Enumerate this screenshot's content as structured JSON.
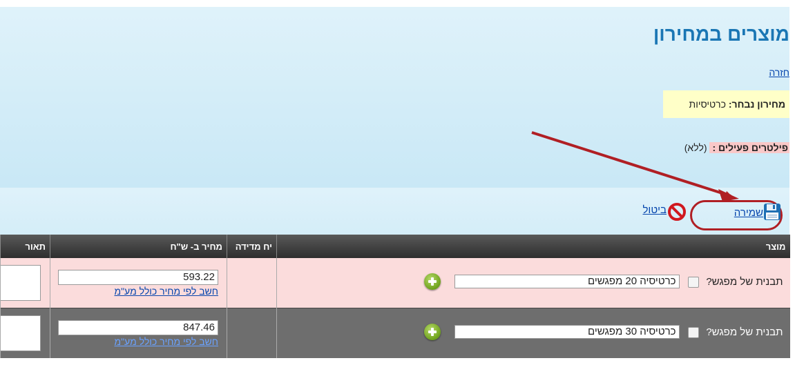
{
  "header": {
    "title": "מוצרים במחירון",
    "back_link": "חזרה",
    "pricelist_label": "מחירון נבחר:",
    "pricelist_value": "כרטיסיות",
    "filters_label": "פילטרים פעילים :",
    "filters_value": "(ללא)"
  },
  "toolbar": {
    "save_label": "שמירה",
    "cancel_label": "ביטול"
  },
  "table": {
    "columns": [
      "מוצר",
      "יח מדידה",
      "מחיר ב- ש\"ח",
      "תאור"
    ],
    "rows": [
      {
        "template_label": "תבנית של מפגש?",
        "product_name": "כרטיסיה 20 מפגשים",
        "unit": "",
        "price": "593.22",
        "calc_link": "חשב לפי מחיר כולל מע\"מ"
      },
      {
        "template_label": "תבנית של מפגש?",
        "product_name": "כרטיסיה 30 מפגשים",
        "unit": "",
        "price": "847.46",
        "calc_link": "חשב לפי מחיר כולל מע\"מ"
      }
    ]
  },
  "colors": {
    "title": "#1a76b4",
    "annotation": "#b01f24",
    "pink_row": "#fbdcdc",
    "dark_row": "#6e6e6e"
  }
}
